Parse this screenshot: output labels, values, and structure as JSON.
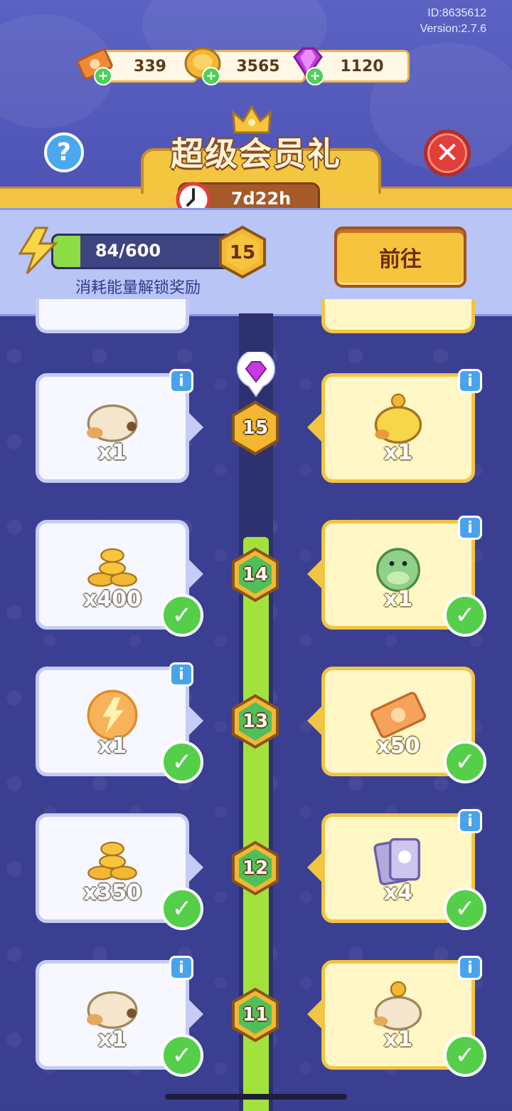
{
  "header": {
    "id_text": "ID:8635612",
    "version_text": "Version:2.7.6"
  },
  "currencies": [
    {
      "name": "ticket",
      "value": "339",
      "color": "#f08a3a"
    },
    {
      "name": "coin",
      "value": "3565",
      "color": "#f2b733"
    },
    {
      "name": "gem",
      "value": "1120",
      "color": "#c43ae0"
    }
  ],
  "banner": {
    "title": "超级会员礼",
    "timer": "7d22h"
  },
  "energy": {
    "progress_text": "84/600",
    "current": 84,
    "max": 600,
    "level": "15",
    "hint": "消耗能量解锁奖励",
    "go_button": "前往"
  },
  "rewards": [
    {
      "level": "15",
      "left": {
        "item": "plush-chick",
        "qty": "x1",
        "claimed": false
      },
      "right": {
        "item": "yellow-chick-pet",
        "qty": "x1",
        "claimed": false
      }
    },
    {
      "level": "14",
      "left": {
        "item": "coin-pile",
        "qty": "x400",
        "claimed": true
      },
      "right": {
        "item": "green-dino-pet",
        "qty": "x1",
        "claimed": true
      }
    },
    {
      "level": "13",
      "left": {
        "item": "energy-orb",
        "qty": "x1",
        "claimed": true
      },
      "right": {
        "item": "ticket",
        "qty": "x50",
        "claimed": true
      }
    },
    {
      "level": "12",
      "left": {
        "item": "coin-pile",
        "qty": "x350",
        "claimed": true
      },
      "right": {
        "item": "cards",
        "qty": "x4",
        "claimed": true
      }
    },
    {
      "level": "11",
      "left": {
        "item": "plush-chick",
        "qty": "x1",
        "claimed": true
      },
      "right": {
        "item": "coin-chick-pet",
        "qty": "x1",
        "claimed": true
      }
    }
  ],
  "icons": {
    "help": "?",
    "close": "✕",
    "info": "i",
    "check": "✓",
    "plus": "+"
  }
}
